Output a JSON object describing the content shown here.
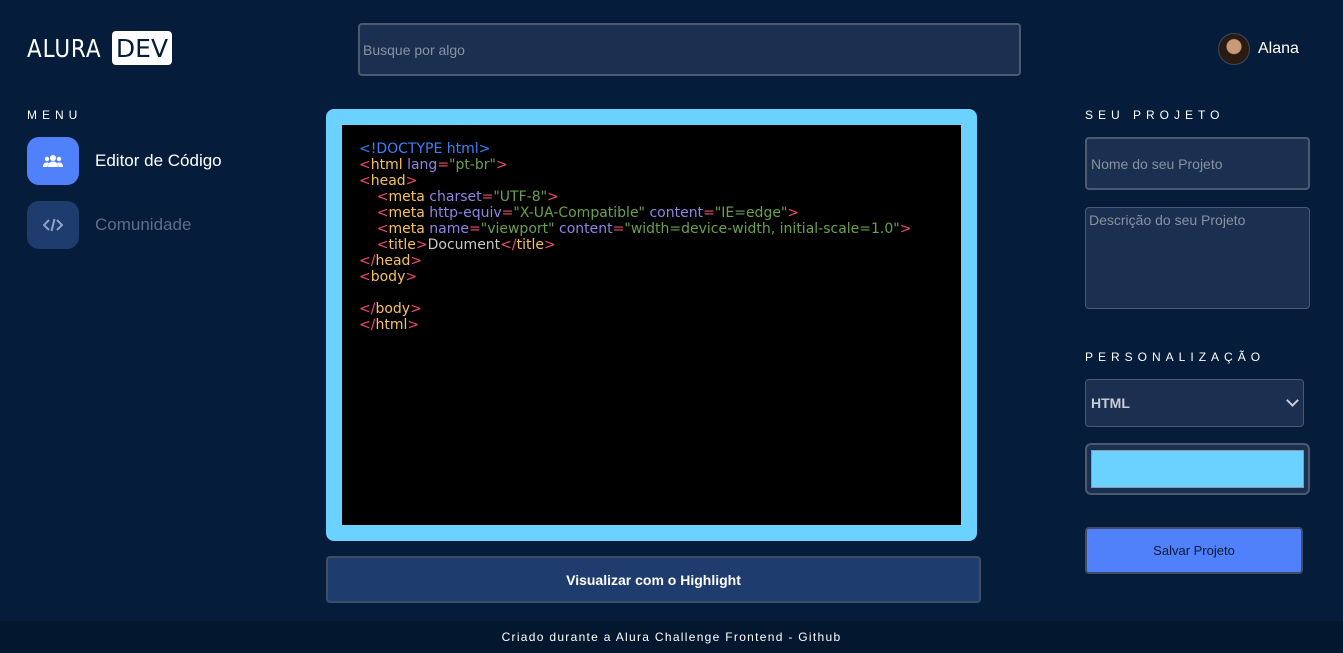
{
  "header": {
    "logo_text": "ALURA",
    "logo_badge": "DEV",
    "search_placeholder": "Busque por algo",
    "user_name": "Alana"
  },
  "menu": {
    "title": "MENU",
    "items": [
      {
        "label": "Editor de Código",
        "icon": "users-icon",
        "active": true,
        "icon_bg": "#5081fb",
        "color": "#ffffff"
      },
      {
        "label": "Comunidade",
        "icon": "code-icon",
        "active": false,
        "icon_bg": "#1f3c6e",
        "color": "#5f6f86"
      }
    ]
  },
  "editor": {
    "lines": [
      [
        {
          "t": "<!DOCTYPE html>",
          "c": "c-doc"
        }
      ],
      [
        {
          "t": "<",
          "c": "c-tag"
        },
        {
          "t": "html",
          "c": "c-name"
        },
        {
          "t": " lang",
          "c": "c-attr"
        },
        {
          "t": "=",
          "c": "c-tag"
        },
        {
          "t": "\"pt-br\"",
          "c": "c-val"
        },
        {
          "t": ">",
          "c": "c-tag"
        }
      ],
      [
        {
          "t": "<",
          "c": "c-tag"
        },
        {
          "t": "head",
          "c": "c-name"
        },
        {
          "t": ">",
          "c": "c-tag"
        }
      ],
      [
        {
          "t": "    <",
          "c": "c-tag"
        },
        {
          "t": "meta",
          "c": "c-name"
        },
        {
          "t": " charset",
          "c": "c-attr"
        },
        {
          "t": "=",
          "c": "c-tag"
        },
        {
          "t": "\"UTF-8\"",
          "c": "c-val"
        },
        {
          "t": ">",
          "c": "c-tag"
        }
      ],
      [
        {
          "t": "    <",
          "c": "c-tag"
        },
        {
          "t": "meta",
          "c": "c-name"
        },
        {
          "t": " http-equiv",
          "c": "c-attr"
        },
        {
          "t": "=",
          "c": "c-tag"
        },
        {
          "t": "\"X-UA-Compatible\"",
          "c": "c-val"
        },
        {
          "t": " content",
          "c": "c-attr"
        },
        {
          "t": "=",
          "c": "c-tag"
        },
        {
          "t": "\"IE=edge\"",
          "c": "c-val"
        },
        {
          "t": ">",
          "c": "c-tag"
        }
      ],
      [
        {
          "t": "    <",
          "c": "c-tag"
        },
        {
          "t": "meta",
          "c": "c-name"
        },
        {
          "t": " name",
          "c": "c-attr"
        },
        {
          "t": "=",
          "c": "c-tag"
        },
        {
          "t": "\"viewport\"",
          "c": "c-val"
        },
        {
          "t": " content",
          "c": "c-attr"
        },
        {
          "t": "=",
          "c": "c-tag"
        },
        {
          "t": "\"width=device-width, initial-scale=1.0\"",
          "c": "c-val"
        },
        {
          "t": ">",
          "c": "c-tag"
        }
      ],
      [
        {
          "t": "    <",
          "c": "c-tag"
        },
        {
          "t": "title",
          "c": "c-name"
        },
        {
          "t": ">",
          "c": "c-tag"
        },
        {
          "t": "Document",
          "c": "c-text"
        },
        {
          "t": "</",
          "c": "c-tag"
        },
        {
          "t": "title",
          "c": "c-name"
        },
        {
          "t": ">",
          "c": "c-tag"
        }
      ],
      [
        {
          "t": "</",
          "c": "c-tag"
        },
        {
          "t": "head",
          "c": "c-name"
        },
        {
          "t": ">",
          "c": "c-tag"
        }
      ],
      [
        {
          "t": "<",
          "c": "c-tag"
        },
        {
          "t": "body",
          "c": "c-name"
        },
        {
          "t": ">",
          "c": "c-tag"
        }
      ],
      [],
      [
        {
          "t": "</",
          "c": "c-tag"
        },
        {
          "t": "body",
          "c": "c-name"
        },
        {
          "t": ">",
          "c": "c-tag"
        }
      ],
      [
        {
          "t": "</",
          "c": "c-tag"
        },
        {
          "t": "html",
          "c": "c-name"
        },
        {
          "t": ">",
          "c": "c-tag"
        }
      ]
    ],
    "frame_color": "#6bd1ff",
    "highlight_button": "Visualizar com o Highlight"
  },
  "project": {
    "title": "SEU PROJETO",
    "name_placeholder": "Nome do seu Projeto",
    "description_placeholder": "Descrição do seu Projeto"
  },
  "customization": {
    "title": "PERSONALIZAÇÃO",
    "language_selected": "HTML",
    "color": "#6bd1ff",
    "save_button": "Salvar Projeto"
  },
  "footer": {
    "text": "Criado durante a Alura Challenge Frontend - Github"
  }
}
